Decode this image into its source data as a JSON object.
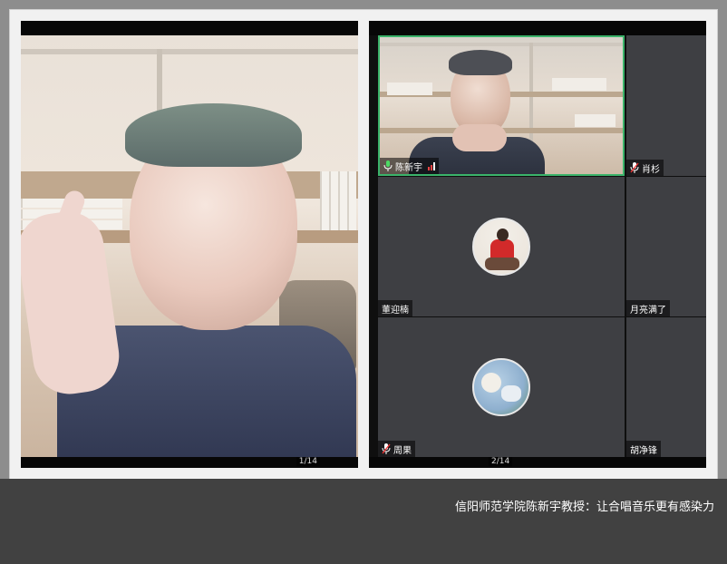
{
  "speaker_page": "1/14",
  "grid_page": "2/14",
  "participants": {
    "active": {
      "name": "陈新宇"
    },
    "p2": {
      "name": "肖杉"
    },
    "p3": {
      "name": "董迎楠"
    },
    "p4": {
      "name": "月亮满了"
    },
    "p5": {
      "name": "周果"
    },
    "p6": {
      "name": "胡净锋"
    }
  },
  "caption": "信阳师范学院陈新宇教授：让合唱音乐更有感染力",
  "colors": {
    "active_border": "#3bb36a",
    "tile_bg": "#3e3f43",
    "caption_bar": "#414141"
  },
  "icons": {
    "mic": "mic-icon",
    "signal": "signal-bars-icon"
  }
}
